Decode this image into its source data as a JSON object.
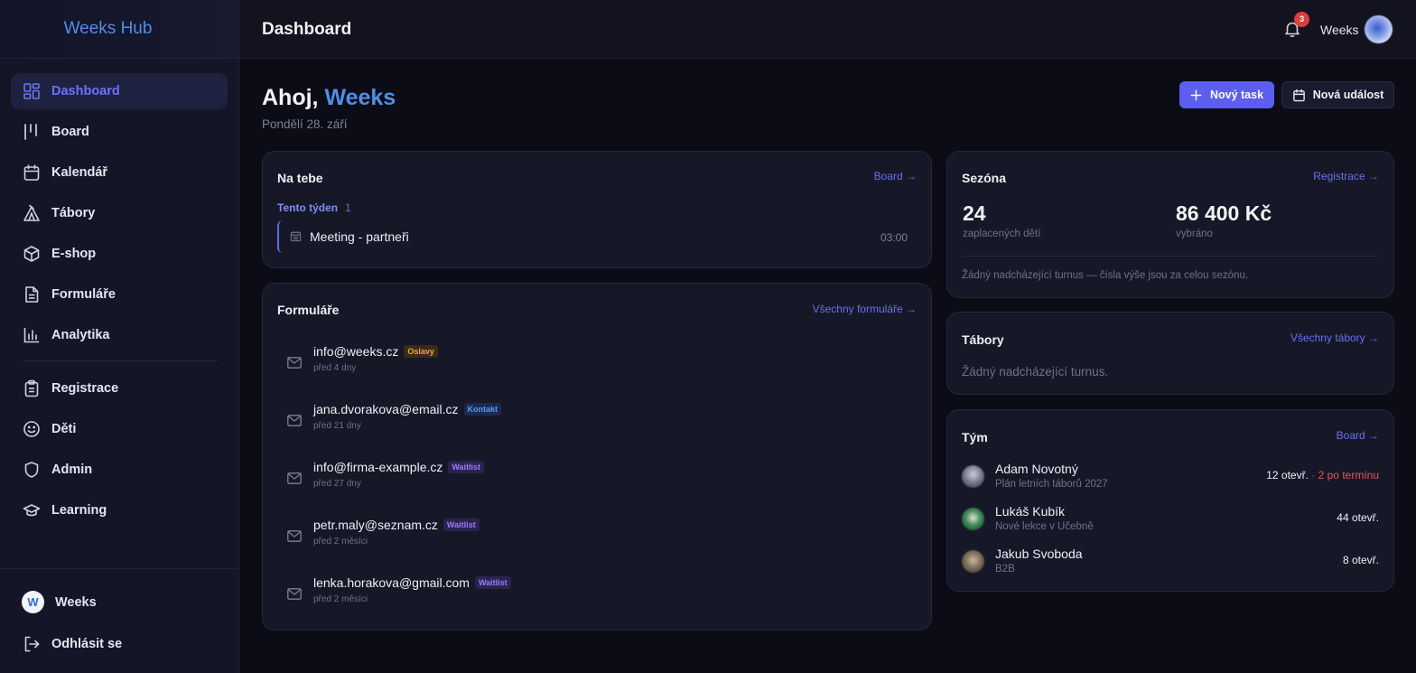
{
  "app": {
    "brand": "Weeks Hub",
    "page_title": "Dashboard"
  },
  "sidebar": {
    "items": [
      {
        "label": "Dashboard",
        "icon": "dashboard-grid-icon",
        "active": true
      },
      {
        "label": "Board",
        "icon": "board-columns-icon"
      },
      {
        "label": "Kalendář",
        "icon": "calendar-icon"
      },
      {
        "label": "Tábory",
        "icon": "tent-icon"
      },
      {
        "label": "E-shop",
        "icon": "package-icon"
      },
      {
        "label": "Formuláře",
        "icon": "document-icon"
      },
      {
        "label": "Analytika",
        "icon": "bar-chart-icon"
      },
      {
        "label": "Registrace",
        "icon": "clipboard-icon"
      },
      {
        "label": "Děti",
        "icon": "smile-icon"
      },
      {
        "label": "Admin",
        "icon": "shield-icon"
      },
      {
        "label": "Learning",
        "icon": "graduation-cap-icon"
      }
    ],
    "user": {
      "logo_letter": "W",
      "name": "Weeks"
    },
    "logout_label": "Odhlásit se"
  },
  "topbar": {
    "notifications_count": "3",
    "user_name": "Weeks"
  },
  "greeting": {
    "prefix": "Ahoj,",
    "name": "Weeks",
    "date": "Pondělí 28. září"
  },
  "actions": {
    "new_task": "Nový task",
    "new_event": "Nová událost"
  },
  "na_tebe": {
    "title": "Na tebe",
    "link": "Board →",
    "week_label": "Tento týden",
    "week_count": "1",
    "tasks": [
      {
        "name": "Meeting - partneři",
        "time": "03:00"
      }
    ]
  },
  "formulare": {
    "title": "Formuláře",
    "link": "Všechny formuláře →",
    "items": [
      {
        "email": "info@weeks.cz",
        "tag": "Oslavy",
        "tag_color": "orange",
        "ago": "před 4 dny"
      },
      {
        "email": "jana.dvorakova@email.cz",
        "tag": "Kontakt",
        "tag_color": "blue",
        "ago": "před 21 dny"
      },
      {
        "email": "info@firma-example.cz",
        "tag": "Waitlist",
        "tag_color": "purple",
        "ago": "před 27 dny"
      },
      {
        "email": "petr.maly@seznam.cz",
        "tag": "Waitlist",
        "tag_color": "purple",
        "ago": "před 2 měsíci"
      },
      {
        "email": "lenka.horakova@gmail.com",
        "tag": "Waitlist",
        "tag_color": "purple",
        "ago": "před 2 měsíci"
      }
    ]
  },
  "sezona": {
    "title": "Sezóna",
    "link": "Registrace →",
    "children_count": "24",
    "children_label": "zaplacených dětí",
    "amount": "86 400 Kč",
    "amount_label": "vybráno",
    "note": "Žádný nadcházející turnus — čísla výše jsou za celou sezónu."
  },
  "tabory": {
    "title": "Tábory",
    "link": "Všechny tábory →",
    "empty": "Žádný nadcházející turnus."
  },
  "tym": {
    "title": "Tým",
    "link": "Board →",
    "members": [
      {
        "name": "Adam Novotný",
        "sub": "Plán letních táborů 2027",
        "open": "12 otevř.",
        "separator": "·",
        "late": "2 po termínu"
      },
      {
        "name": "Lukáš Kubík",
        "sub": "Nové lekce v Učebně",
        "open": "44 otevř."
      },
      {
        "name": "Jakub Svoboda",
        "sub": "B2B",
        "open": "8 otevř."
      }
    ]
  },
  "colors": {
    "accent": "#5b5ef0",
    "brand_blue": "#4f8fe6",
    "danger": "#e45656",
    "background": "#0b0c16"
  }
}
